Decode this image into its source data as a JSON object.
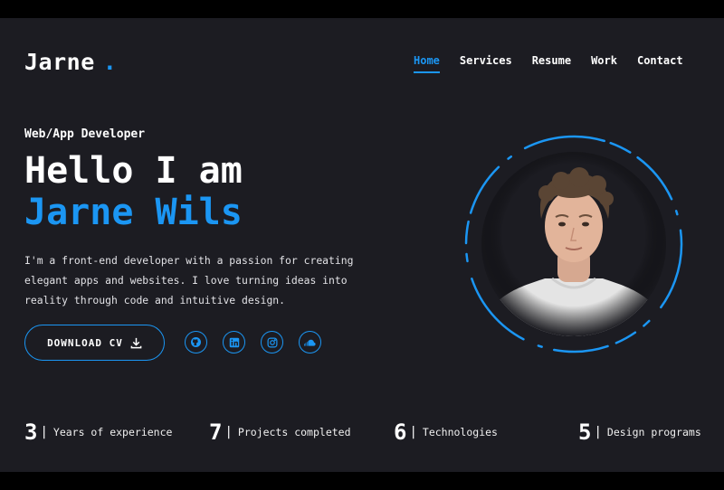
{
  "header": {
    "logo": "Jarne",
    "logo_dot": ".",
    "nav": [
      "Home",
      "Services",
      "Resume",
      "Work",
      "Contact"
    ],
    "active_nav": "Home"
  },
  "hero": {
    "role": "Web/App Developer",
    "greeting": "Hello I am",
    "name": "Jarne Wils",
    "intro_lines": [
      "I'm a front-end developer with a passion for creating",
      "elegant apps and websites. I love turning ideas into",
      "reality through code and intuitive design."
    ],
    "cv_button": "DOWNLOAD CV",
    "socials": [
      "github-icon",
      "linkedin-icon",
      "instagram-icon",
      "soundcloud-icon"
    ]
  },
  "stats": [
    {
      "num": "3",
      "label": "Years of experience"
    },
    {
      "num": "7",
      "label": "Projects completed"
    },
    {
      "num": "6",
      "label": "Technologies"
    },
    {
      "num": "5",
      "label": "Design programs"
    }
  ],
  "colors": {
    "accent": "#1b96f3",
    "background": "#1c1c22"
  }
}
